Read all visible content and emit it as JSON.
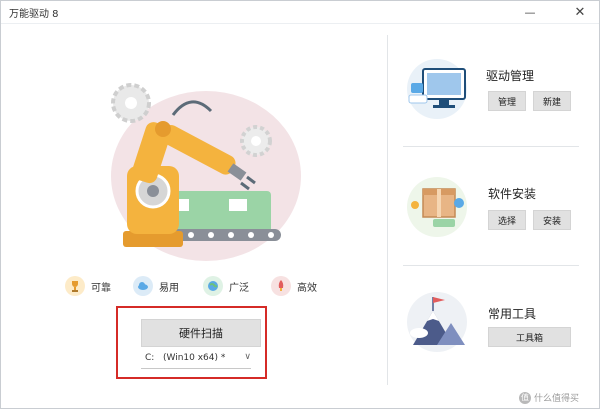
{
  "window": {
    "title": "万能驱动 8",
    "minimize_glyph": "—",
    "close_glyph": "✕"
  },
  "features": [
    {
      "label": "可靠",
      "icon": "trophy-icon"
    },
    {
      "label": "易用",
      "icon": "cloud-icon"
    },
    {
      "label": "广泛",
      "icon": "globe-icon"
    },
    {
      "label": "高效",
      "icon": "rocket-icon"
    }
  ],
  "scan": {
    "button_label": "硬件扫描",
    "drive_letter": "C:",
    "drive_value": "(Win10 x64) *",
    "chevron": "∨"
  },
  "sections": {
    "driver_mgmt": {
      "title": "驱动管理",
      "buttons": [
        "管理",
        "新建"
      ],
      "icon": "monitor-icon"
    },
    "software_install": {
      "title": "软件安装",
      "buttons": [
        "选择",
        "安装"
      ],
      "icon": "package-icon"
    },
    "tools": {
      "title": "常用工具",
      "buttons": [
        "工具箱"
      ],
      "icon": "mountain-flag-icon"
    }
  },
  "watermark": {
    "logo": "值",
    "text": "什么值得买"
  },
  "colors": {
    "accent_red": "#d52b27",
    "button_gray": "#e1e1e1",
    "robot_orange": "#f4b33e",
    "conveyor_green": "#8fcf9a"
  }
}
